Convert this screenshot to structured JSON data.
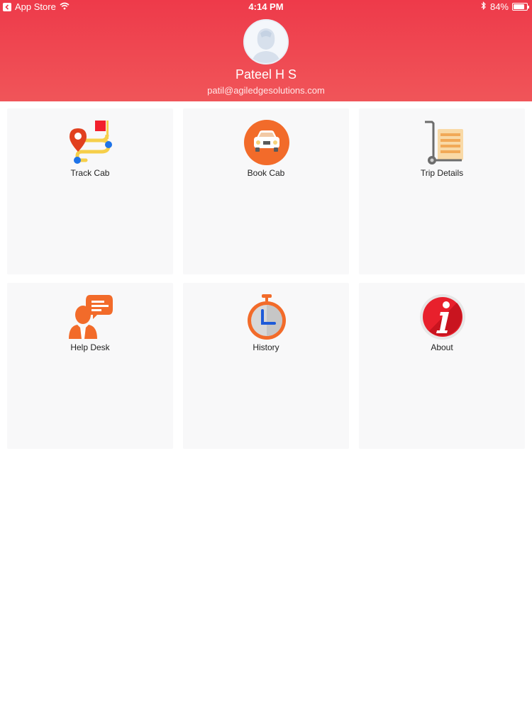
{
  "status_bar": {
    "back_app": "App Store",
    "time": "4:14 PM",
    "battery": "84%",
    "battery_level": 0.84
  },
  "profile": {
    "name": "Pateel H S",
    "email": "patil@agiledgesolutions.com"
  },
  "menu": [
    {
      "label": "Track Cab",
      "icon": "map-route-icon"
    },
    {
      "label": "Book Cab",
      "icon": "car-icon"
    },
    {
      "label": "Trip Details",
      "icon": "trolley-icon"
    },
    {
      "label": "Help Desk",
      "icon": "support-chat-icon"
    },
    {
      "label": "History",
      "icon": "stopwatch-icon"
    },
    {
      "label": "About",
      "icon": "info-icon"
    }
  ],
  "colors": {
    "header": "#ee3a4a",
    "accent_orange": "#f26b2a",
    "tile_bg": "#f8f8f9"
  }
}
